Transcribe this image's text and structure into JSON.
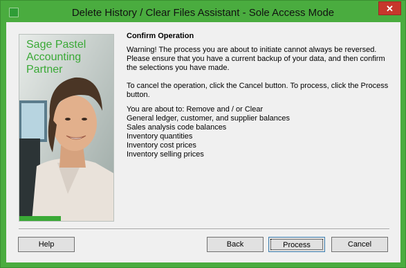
{
  "window": {
    "title": "Delete History / Clear Files Assistant - Sole Access Mode",
    "close_label": "✕",
    "accent_color": "#4aac3f"
  },
  "brand": {
    "line1": "Sage Pastel",
    "line2": "Accounting",
    "line3": "Partner",
    "color": "#3aa936"
  },
  "content": {
    "heading": "Confirm Operation",
    "warning": "Warning! The process you are about to initiate cannot always be reversed. Please ensure that you have a current backup of your data, and then confirm the selections you have made.",
    "instructions": "To cancel the operation, click the Cancel button. To process, click the Process button.",
    "items": [
      "You are about to: Remove and / or Clear",
      "General ledger, customer, and supplier balances",
      "Sales analysis code balances",
      "Inventory quantities",
      "Inventory cost prices",
      "Inventory selling prices"
    ]
  },
  "buttons": {
    "help": "Help",
    "back": "Back",
    "process": "Process",
    "cancel": "Cancel"
  }
}
